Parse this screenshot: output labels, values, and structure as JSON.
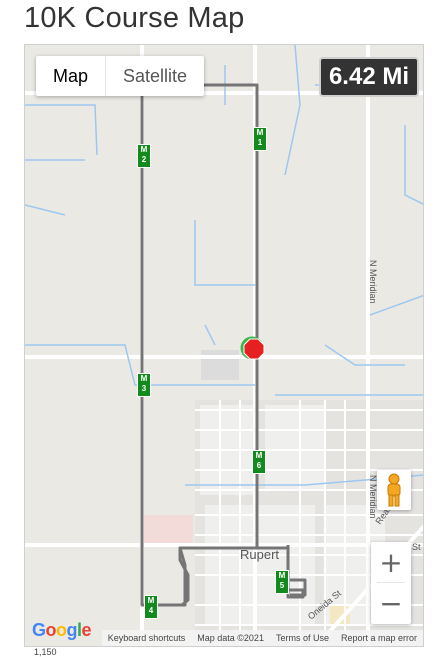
{
  "page": {
    "title": "10K Course Map"
  },
  "map": {
    "type_control": {
      "map_label": "Map",
      "satellite_label": "Satellite",
      "selected": "Map"
    },
    "distance_badge": "6.42 Mi",
    "mile_markers": [
      {
        "label": "M 1"
      },
      {
        "label": "M 2"
      },
      {
        "label": "M 3"
      },
      {
        "label": "M 4"
      },
      {
        "label": "M 5"
      },
      {
        "label": "M 6"
      }
    ],
    "place_labels": {
      "town": "Rupert",
      "road1": "N Meridian",
      "road2": "N Meridian",
      "road3": "Oneida St",
      "road4": "Read",
      "road5": "St"
    },
    "zoom": {
      "in": "+",
      "out": "−"
    },
    "attribution": {
      "logo": "Google",
      "shortcuts": "Keyboard shortcuts",
      "map_data": "Map data ©2021",
      "terms": "Terms of Use",
      "report": "Report a map error"
    },
    "scale_text": "1,150"
  },
  "colors": {
    "route": "#757575",
    "marker": "#138a1d",
    "stop": "#e62020",
    "start": "#3cb84a"
  }
}
